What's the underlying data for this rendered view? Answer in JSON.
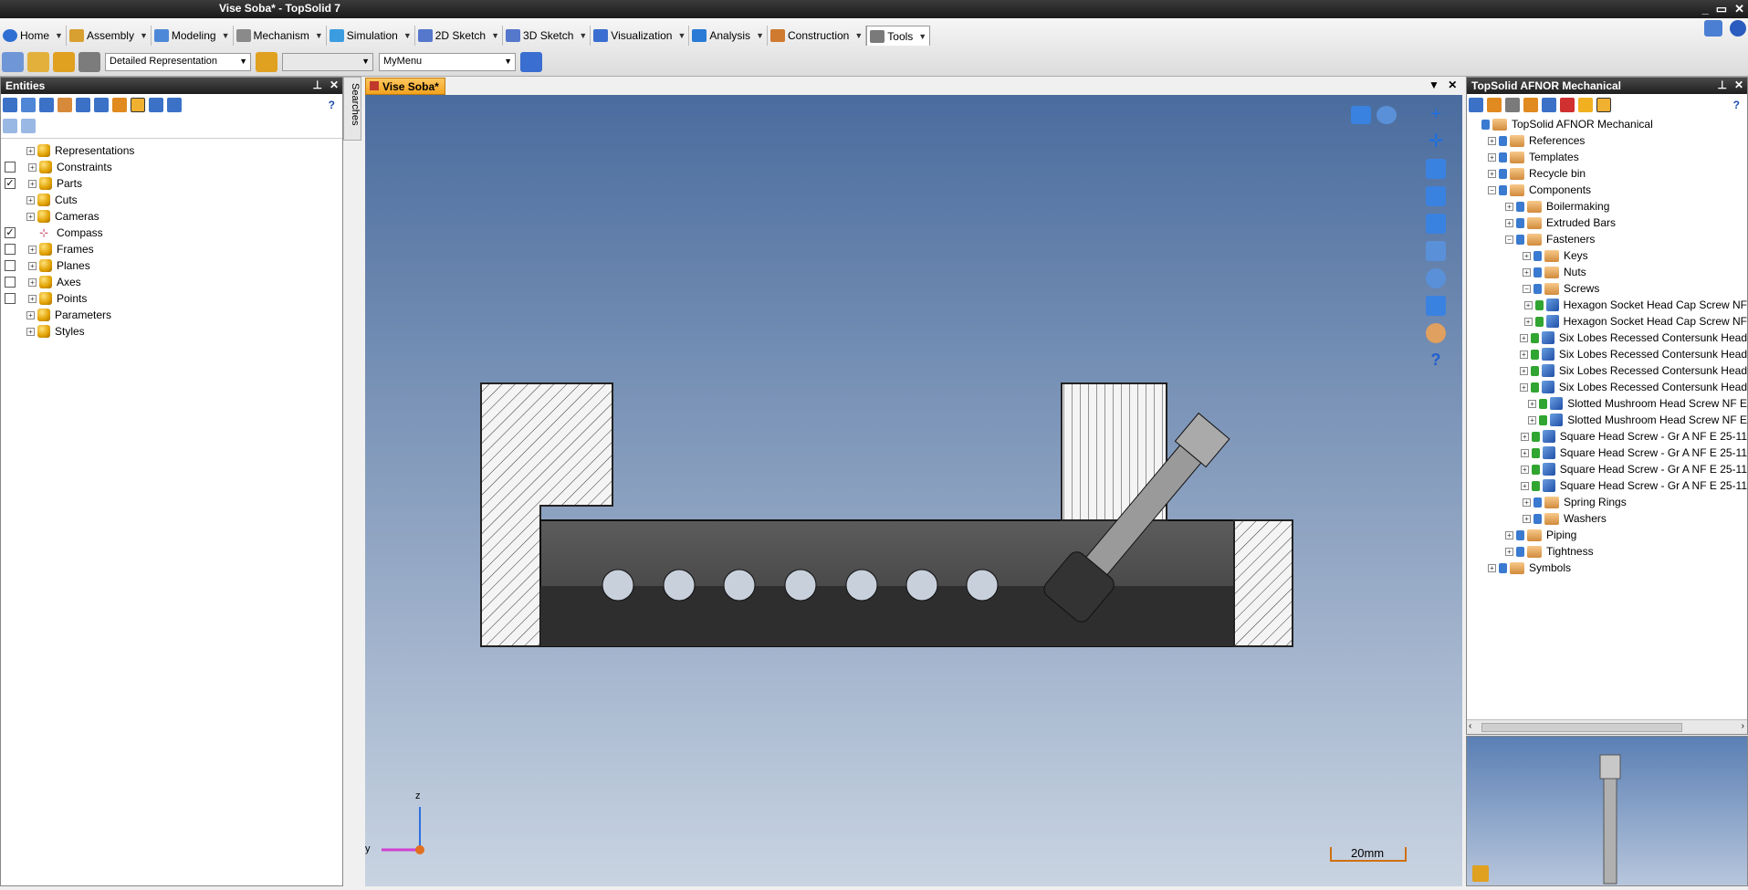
{
  "window": {
    "title": "Vise Soba* - TopSolid 7",
    "controls": [
      "_",
      "▭",
      "✕"
    ]
  },
  "ribbon": {
    "tabs": [
      {
        "label": "Home",
        "icon": "home-icon"
      },
      {
        "label": "Assembly",
        "icon": "assembly-icon"
      },
      {
        "label": "Modeling",
        "icon": "modeling-icon"
      },
      {
        "label": "Mechanism",
        "icon": "mechanism-icon"
      },
      {
        "label": "Simulation",
        "icon": "simulation-icon"
      },
      {
        "label": "2D Sketch",
        "icon": "sketch2d-icon"
      },
      {
        "label": "3D Sketch",
        "icon": "sketch3d-icon"
      },
      {
        "label": "Visualization",
        "icon": "visualization-icon"
      },
      {
        "label": "Analysis",
        "icon": "analysis-icon"
      },
      {
        "label": "Construction",
        "icon": "construction-icon"
      },
      {
        "label": "Tools",
        "icon": "tools-icon"
      }
    ],
    "representation_value": "Detailed Representation",
    "empty_combo_value": "",
    "menu_value": "MyMenu"
  },
  "entities": {
    "title": "Entities",
    "help": "?",
    "items": [
      {
        "label": "Representations",
        "checkbox": "none"
      },
      {
        "label": "Constraints",
        "checkbox": "unchecked"
      },
      {
        "label": "Parts",
        "checkbox": "checked"
      },
      {
        "label": "Cuts",
        "checkbox": "none"
      },
      {
        "label": "Cameras",
        "checkbox": "none"
      },
      {
        "label": "Compass",
        "checkbox": "checked"
      },
      {
        "label": "Frames",
        "checkbox": "unchecked"
      },
      {
        "label": "Planes",
        "checkbox": "unchecked"
      },
      {
        "label": "Axes",
        "checkbox": "unchecked"
      },
      {
        "label": "Points",
        "checkbox": "unchecked"
      },
      {
        "label": "Parameters",
        "checkbox": "none"
      },
      {
        "label": "Styles",
        "checkbox": "none"
      }
    ]
  },
  "searches_tab": "Searches",
  "document": {
    "tab_label": "Vise Soba*",
    "scale_label": "20mm"
  },
  "library": {
    "title": "TopSolid AFNOR Mechanical",
    "help": "?",
    "tree": [
      {
        "label": "TopSolid AFNOR Mechanical",
        "level": 0
      },
      {
        "label": "References",
        "level": 1
      },
      {
        "label": "Templates",
        "level": 1
      },
      {
        "label": "Recycle bin",
        "level": 1
      },
      {
        "label": "Components",
        "level": 1
      },
      {
        "label": "Boilermaking",
        "level": 2
      },
      {
        "label": "Extruded Bars",
        "level": 2
      },
      {
        "label": "Fasteners",
        "level": 2
      },
      {
        "label": "Keys",
        "level": 3
      },
      {
        "label": "Nuts",
        "level": 3
      },
      {
        "label": "Screws",
        "level": 3
      },
      {
        "label": "Hexagon Socket Head Cap Screw NF",
        "level": 4
      },
      {
        "label": "Hexagon Socket Head Cap Screw NF",
        "level": 4
      },
      {
        "label": "Six Lobes Recessed Contersunk Head",
        "level": 4
      },
      {
        "label": "Six Lobes Recessed Contersunk Head",
        "level": 4
      },
      {
        "label": "Six Lobes Recessed Contersunk Head",
        "level": 4
      },
      {
        "label": "Six Lobes Recessed Contersunk Head",
        "level": 4
      },
      {
        "label": "Slotted Mushroom Head Screw NF E",
        "level": 4
      },
      {
        "label": "Slotted Mushroom Head Screw NF E",
        "level": 4
      },
      {
        "label": "Square Head Screw - Gr A NF E 25-11",
        "level": 4
      },
      {
        "label": "Square Head Screw - Gr A NF E 25-11",
        "level": 4
      },
      {
        "label": "Square Head Screw - Gr A NF E 25-11",
        "level": 4
      },
      {
        "label": "Square Head Screw - Gr A NF E 25-11",
        "level": 4
      },
      {
        "label": "Spring Rings",
        "level": 3
      },
      {
        "label": "Washers",
        "level": 3
      },
      {
        "label": "Piping",
        "level": 2
      },
      {
        "label": "Tightness",
        "level": 2
      },
      {
        "label": "Symbols",
        "level": 1
      }
    ]
  },
  "axes": {
    "z": "z",
    "y": "y"
  }
}
